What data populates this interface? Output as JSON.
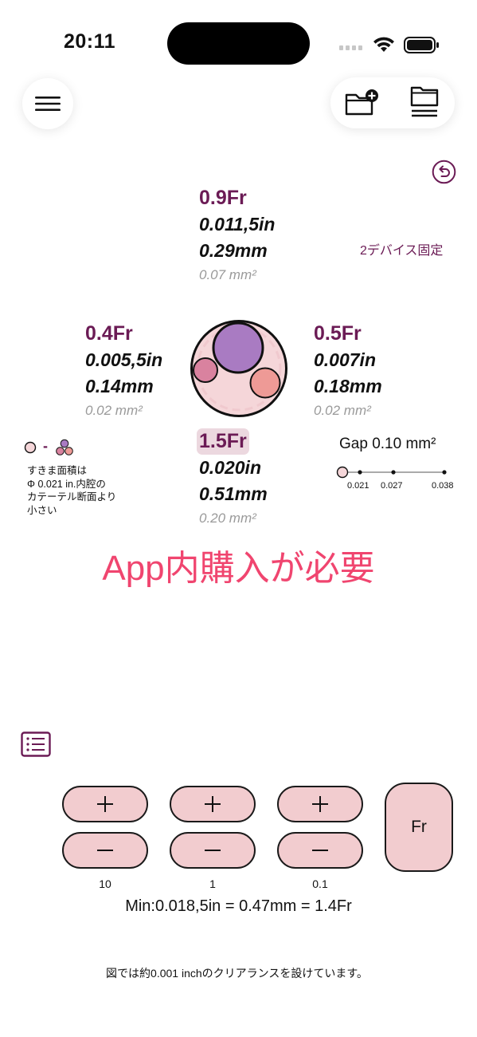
{
  "status_bar": {
    "time": "20:11"
  },
  "devices": {
    "top": {
      "fr": "0.9Fr",
      "inch": "0.011,5in",
      "mm": "0.29mm",
      "area": "0.07 mm²"
    },
    "left": {
      "fr": "0.4Fr",
      "inch": "0.005,5in",
      "mm": "0.14mm",
      "area": "0.02 mm²"
    },
    "right": {
      "fr": "0.5Fr",
      "inch": "0.007in",
      "mm": "0.18mm",
      "area": "0.02 mm²"
    },
    "center": {
      "fr": "1.5Fr",
      "inch": "0.020in",
      "mm": "0.51mm",
      "area": "0.20 mm²"
    }
  },
  "lock_label": "2デバイス固定",
  "legend": {
    "dash": "-",
    "lines": [
      "すきま面積は",
      "Φ 0.021 in.内腔の",
      "カテーテル断面より",
      "小さい"
    ]
  },
  "gap": {
    "title": "Gap 0.10 mm²",
    "ticks": [
      "0.021",
      "0.027",
      "0.038"
    ]
  },
  "iap_notice": "App内購入が必要",
  "steppers": {
    "plus_label": "+",
    "minus_label": "−",
    "step_labels": [
      "10",
      "1",
      "0.1"
    ],
    "unit_button": "Fr"
  },
  "min_line": "Min:0.018,5in = 0.47mm = 1.4Fr",
  "footnote": "図では約0.001 inchのクリアランスを設けています。",
  "colors": {
    "accent": "#6b1b55",
    "button_fill": "#f2cccf",
    "iap_red": "#f0456f",
    "circle_purple": "#a97bc2",
    "circle_pink": "#d9829f",
    "circle_salmon": "#ee9a96",
    "outer_circle": "#f5d6d9"
  },
  "icons": {
    "menu": "hamburger-icon",
    "folder_add": "folder-plus-icon",
    "folder_list": "folder-list-icon",
    "undo": "undo-icon",
    "list": "list-icon",
    "wifi": "wifi-icon",
    "battery": "battery-icon"
  }
}
